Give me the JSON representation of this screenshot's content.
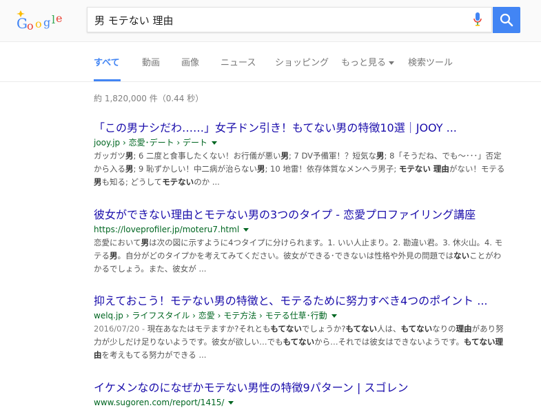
{
  "search": {
    "query": "男 モテない 理由"
  },
  "tabs": [
    {
      "label": "すべて"
    },
    {
      "label": "動画"
    },
    {
      "label": "画像"
    },
    {
      "label": "ニュース"
    },
    {
      "label": "ショッピング"
    },
    {
      "label": "もっと見る"
    },
    {
      "label": "検索ツール"
    }
  ],
  "stats": "約 1,820,000 件（0.44 秒）",
  "results": [
    {
      "title": "「この男ナシだわ……」女子ドン引き！もてない男の特徴10選｜JOOY ...",
      "url": "jooy.jp › 恋愛･デート › デート",
      "snippet": [
        {
          "t": "ガッガツ"
        },
        {
          "t": "男",
          "b": true
        },
        {
          "t": "; 6 二度と食事したくない！お行儀が悪い"
        },
        {
          "t": "男",
          "b": true
        },
        {
          "t": "; 7 DV予備軍！？短気な"
        },
        {
          "t": "男",
          "b": true
        },
        {
          "t": "; 8「そうだね、でも〜･･･」否定から入る"
        },
        {
          "t": "男",
          "b": true
        },
        {
          "t": "; 9 恥ずかしい！中二病が治らない"
        },
        {
          "t": "男",
          "b": true
        },
        {
          "t": "; 10 地雷！依存体質なメンヘラ男子; "
        },
        {
          "t": "モテない 理由",
          "b": true
        },
        {
          "t": "がない！モテる"
        },
        {
          "t": "男",
          "b": true
        },
        {
          "t": "も知る; どうして"
        },
        {
          "t": "モテない",
          "b": true
        },
        {
          "t": "のか ..."
        }
      ]
    },
    {
      "title": "彼女ができない理由とモテない男の3つのタイプ - 恋愛プロファイリング講座",
      "url": "https://loveprofiler.jp/moteru7.html",
      "snippet": [
        {
          "t": "恋愛において"
        },
        {
          "t": "男",
          "b": true
        },
        {
          "t": "は次の図に示すように4つタイプに分けられます。1. いい人止まり。2. 勘違い君。3. 休火山。4. モテる"
        },
        {
          "t": "男",
          "b": true
        },
        {
          "t": "。自分がどのタイプかを考えてみてください。彼女ができる･できないは性格や外見の問題では"
        },
        {
          "t": "ない",
          "b": true
        },
        {
          "t": "ことがわかるでしょう。また、彼女が ..."
        }
      ]
    },
    {
      "title": "抑えておこう！モテない男の特徴と、モテるために努力すべき4つのポイント ...",
      "url": "welq.jp › ライフスタイル › 恋愛 › モテ方法 › モテる仕草･行動",
      "date": "2016/07/20 - ",
      "snippet": [
        {
          "t": "現在あなたはモテますか?それとも"
        },
        {
          "t": "もてない",
          "b": true
        },
        {
          "t": "でしょうか?"
        },
        {
          "t": "もてない",
          "b": true
        },
        {
          "t": "人は、"
        },
        {
          "t": "もてない",
          "b": true
        },
        {
          "t": "なりの"
        },
        {
          "t": "理由",
          "b": true
        },
        {
          "t": "があり努力が少しだけ足りないようです。彼女が欲しい…でも"
        },
        {
          "t": "もてない",
          "b": true
        },
        {
          "t": "から…それでは彼女はできないようです。"
        },
        {
          "t": "もてない理由",
          "b": true
        },
        {
          "t": "を考えもてる努力ができる ..."
        }
      ]
    },
    {
      "title": "イケメンなのになぜかモテない男性の特徴9パターン | スゴレン",
      "url": "www.sugoren.com/report/1415/"
    }
  ]
}
